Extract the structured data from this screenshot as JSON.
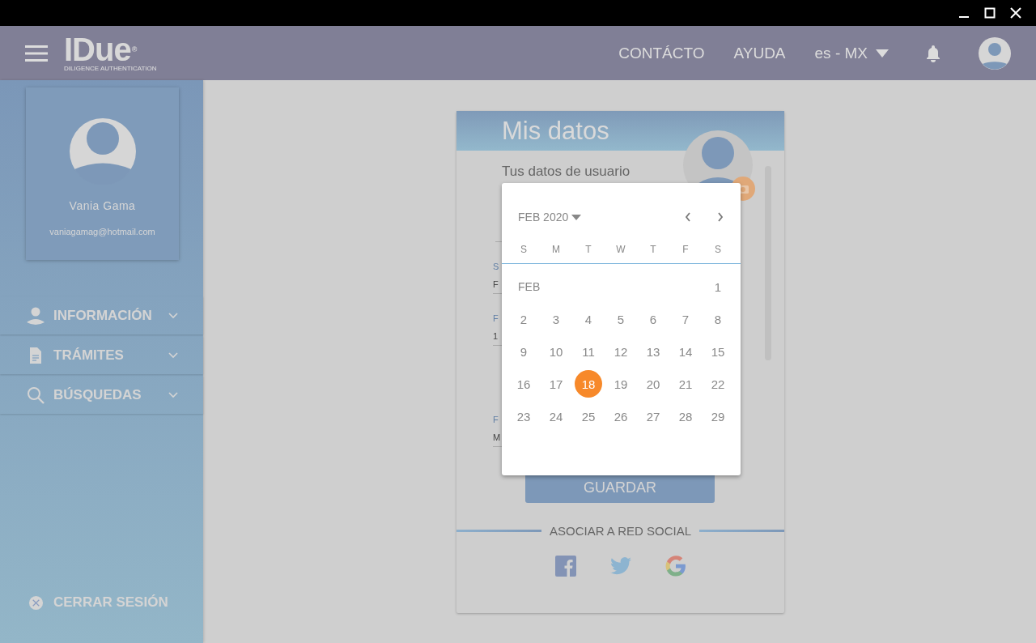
{
  "header": {
    "logo": "IDue$^{®}$",
    "logo_tagline": "DILIGENCE AUTHENTICATION",
    "nav": [
      "CONTÁCTO",
      "AYUDA"
    ],
    "language": "es - MX"
  },
  "sidebar": {
    "profile": {
      "name": "Vania Gama",
      "email": "vaniagamag@hotmail.com"
    },
    "menu": [
      {
        "label": "INFORMACIÓN"
      },
      {
        "label": "TRÁMITES"
      },
      {
        "label": "BÚSQUEDAS"
      }
    ],
    "logout": "CERRAR SESIÓN"
  },
  "card": {
    "title": "Mis datos",
    "subtitle": "Tus datos de usuario",
    "fields": [
      {
        "label": "S",
        "value": "F"
      },
      {
        "label": "F",
        "value": "1"
      },
      {
        "label": "F",
        "value": "M"
      }
    ],
    "save_button": "GUARDAR",
    "social_heading": "ASOCIAR A RED SOCIAL"
  },
  "datepicker": {
    "month_label": "FEB 2020",
    "month_marker": "FEB",
    "weekdays": [
      "S",
      "M",
      "T",
      "W",
      "T",
      "F",
      "S"
    ],
    "weeks": [
      [
        {
          "label": "1",
          "selected": false
        }
      ],
      [
        {
          "label": "2",
          "selected": false
        },
        {
          "label": "3",
          "selected": false
        },
        {
          "label": "4",
          "selected": false
        },
        {
          "label": "5",
          "selected": false
        },
        {
          "label": "6",
          "selected": false
        },
        {
          "label": "7",
          "selected": false
        },
        {
          "label": "8",
          "selected": false
        }
      ],
      [
        {
          "label": "9",
          "selected": false
        },
        {
          "label": "10",
          "selected": false
        },
        {
          "label": "11",
          "selected": false
        },
        {
          "label": "12",
          "selected": false
        },
        {
          "label": "13",
          "selected": false
        },
        {
          "label": "14",
          "selected": false
        },
        {
          "label": "15",
          "selected": false
        }
      ],
      [
        {
          "label": "16",
          "selected": false
        },
        {
          "label": "17",
          "selected": false
        },
        {
          "label": "18",
          "selected": true
        },
        {
          "label": "19",
          "selected": false
        },
        {
          "label": "20",
          "selected": false
        },
        {
          "label": "21",
          "selected": false
        },
        {
          "label": "22",
          "selected": false
        }
      ],
      [
        {
          "label": "23",
          "selected": false
        },
        {
          "label": "24",
          "selected": false
        },
        {
          "label": "25",
          "selected": false
        },
        {
          "label": "26",
          "selected": false
        },
        {
          "label": "27",
          "selected": false
        },
        {
          "label": "28",
          "selected": false
        },
        {
          "label": "29",
          "selected": false
        }
      ]
    ]
  }
}
